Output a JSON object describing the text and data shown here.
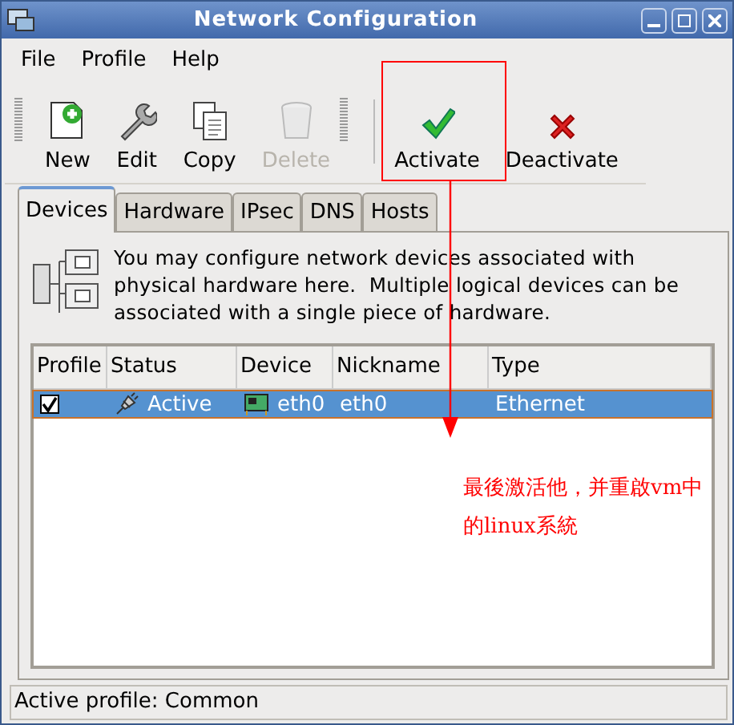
{
  "window": {
    "title": "Network Configuration"
  },
  "menu": [
    {
      "label": "File"
    },
    {
      "label": "Profile"
    },
    {
      "label": "Help"
    }
  ],
  "toolbar": {
    "groups": [
      [
        {
          "label": "New",
          "kind": "new",
          "disabled": false
        },
        {
          "label": "Edit",
          "kind": "edit",
          "disabled": false
        },
        {
          "label": "Copy",
          "kind": "copy",
          "disabled": false
        },
        {
          "label": "Delete",
          "kind": "delete",
          "disabled": true
        }
      ],
      [
        {
          "label": "Activate",
          "kind": "activate",
          "disabled": false
        },
        {
          "label": "Deactivate",
          "kind": "deactivate",
          "disabled": false
        }
      ]
    ]
  },
  "tabs": [
    {
      "label": "Devices",
      "selected": true
    },
    {
      "label": "Hardware",
      "selected": false
    },
    {
      "label": "IPsec",
      "selected": false
    },
    {
      "label": "DNS",
      "selected": false
    },
    {
      "label": "Hosts",
      "selected": false
    }
  ],
  "description": "You may configure network devices associated with physical hardware here.  Multiple logical devices can be associated with a single piece of hardware.",
  "table": {
    "columns": [
      "Profile",
      "Status",
      "Device",
      "Nickname",
      "Type"
    ],
    "rows": [
      {
        "profile_checked": true,
        "status": "Active",
        "device": "eth0",
        "nickname": "eth0",
        "type": "Ethernet",
        "selected": true
      }
    ]
  },
  "status_bar": "Active profile: Common",
  "annotation": {
    "lines": [
      "最後激活他，并重啟vm中",
      "的linux系統"
    ]
  }
}
